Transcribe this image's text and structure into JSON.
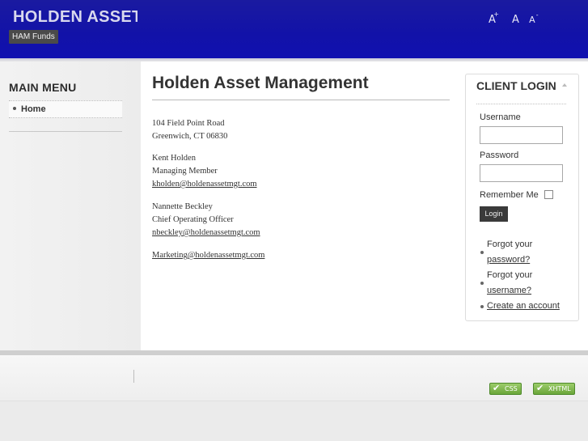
{
  "header": {
    "site_title": "HOLDEN ASSET",
    "tagline": "HAM Funds",
    "font_tools": {
      "increase": "A",
      "reset": "A",
      "decrease": "A",
      "plus": "+",
      "minus": "-"
    }
  },
  "left": {
    "menu_title": "MAIN MENU",
    "menu_items": [
      {
        "label": "Home"
      }
    ]
  },
  "main": {
    "title": "Holden Asset Management",
    "address_line1": "104 Field Point Road",
    "address_line2": "Greenwich, CT  06830",
    "contact1_name": "Kent Holden",
    "contact1_role": "Managing Member",
    "contact1_email": "kholden@holdenassetmgt.com",
    "contact2_name": "Nannette Beckley",
    "contact2_role": "Chief Operating Officer",
    "contact2_email": "nbeckley@holdenassetmgt.com",
    "marketing_email": "Marketing@holdenassetmgt.com"
  },
  "login": {
    "title": "CLIENT LOGIN",
    "username_label": "Username",
    "username_value": "",
    "password_label": "Password",
    "password_value": "",
    "remember_label": "Remember Me",
    "button_label": "Login",
    "forgot_password_line1": "Forgot your",
    "forgot_password_line2": "password?",
    "forgot_username_line1": "Forgot your",
    "forgot_username_line2": "username?",
    "create_account": "Create an account"
  },
  "footer": {
    "badge_css": "CSS",
    "badge_xhtml": "XHTML"
  },
  "colors": {
    "header_blue": "#1212a8",
    "badge_green": "#6aa63a"
  }
}
